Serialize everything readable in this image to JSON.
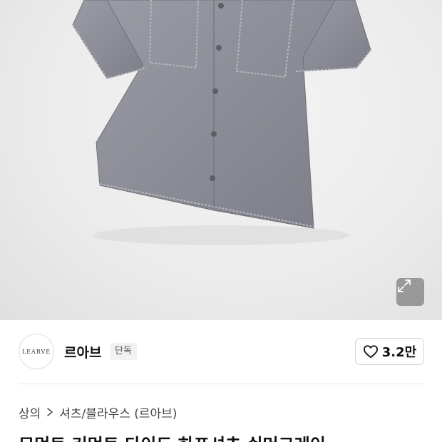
{
  "product_image": {
    "alt_icon": "shirt-photo"
  },
  "expand_icon": "expand-icon",
  "brand": {
    "logo_text": "LEARVE",
    "name": "르아브",
    "badge": "단독"
  },
  "like": {
    "icon": "heart-outline-icon",
    "count": "3.2만"
  },
  "breadcrumb": {
    "items": [
      "상의",
      "셔츠/블라우스 (르아브)"
    ]
  },
  "title": {
    "text": "모먼트 커먼트 다이드 하프셔츠 쉬머그레이"
  },
  "colors": {
    "shirt": "#8c8d96",
    "hero_bg": "#ececec",
    "badge_bg": "#f2f2f2"
  }
}
